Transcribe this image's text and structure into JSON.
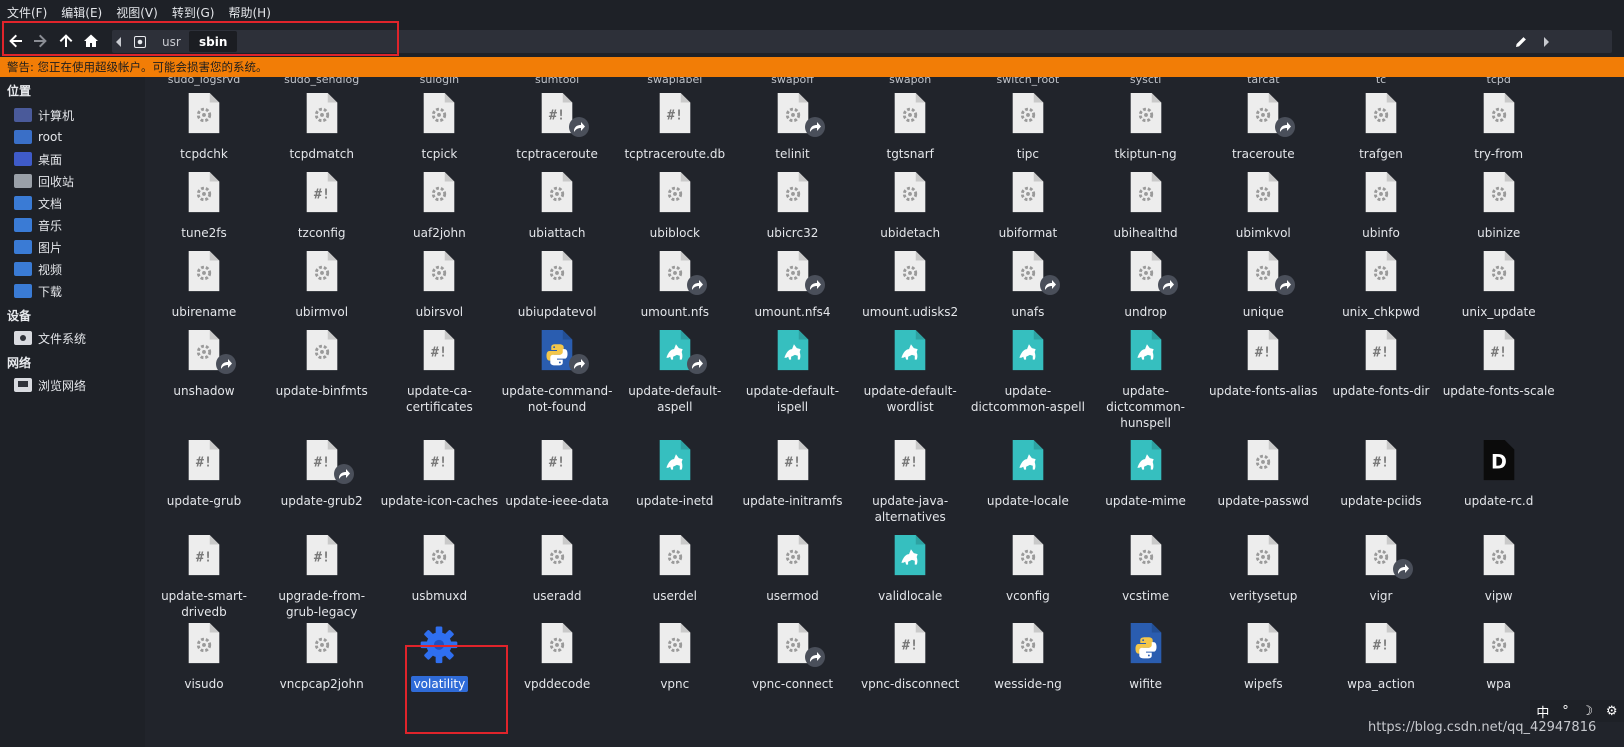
{
  "menu": [
    "文件(F)",
    "编辑(E)",
    "视图(V)",
    "转到(G)",
    "帮助(H)"
  ],
  "path": {
    "crumbs": [
      "usr",
      "sbin"
    ]
  },
  "warning": "警告: 您正在使用超级帐户。可能会损害您的系统。",
  "sidebar": {
    "headings": [
      "位置",
      "设备",
      "网络"
    ],
    "places": [
      {
        "label": "计算机",
        "icon": "computer-icon",
        "color": "#4a5a9a"
      },
      {
        "label": "root",
        "icon": "home-folder-icon",
        "color": "#3a6fc7"
      },
      {
        "label": "桌面",
        "icon": "desktop-icon",
        "color": "#3f5bc9"
      },
      {
        "label": "回收站",
        "icon": "trash-icon",
        "color": "#9aa0a8"
      },
      {
        "label": "文档",
        "icon": "documents-icon",
        "color": "#3a7bd5"
      },
      {
        "label": "音乐",
        "icon": "music-icon",
        "color": "#3a7bd5"
      },
      {
        "label": "图片",
        "icon": "pictures-icon",
        "color": "#3a7bd5"
      },
      {
        "label": "视频",
        "icon": "videos-icon",
        "color": "#3a7bd5"
      },
      {
        "label": "下载",
        "icon": "downloads-icon",
        "color": "#3a7bd5"
      }
    ],
    "devices": [
      {
        "label": "文件系统",
        "icon": "drive-icon"
      }
    ],
    "network": [
      {
        "label": "浏览网络",
        "icon": "network-icon"
      }
    ]
  },
  "top_partial_row": [
    "sudo_logsrvd",
    "sudo_sendlog",
    "sulogin",
    "sumtool",
    "swaplabel",
    "swapoff",
    "swapon",
    "switch_root",
    "sysctl",
    "tarcat",
    "tc",
    "tcpd"
  ],
  "rows": [
    [
      {
        "name": "tcpdchk",
        "type": "binary",
        "link": false
      },
      {
        "name": "tcpdmatch",
        "type": "binary",
        "link": false
      },
      {
        "name": "tcpick",
        "type": "binary",
        "link": false
      },
      {
        "name": "tcptraceroute",
        "type": "script",
        "link": true
      },
      {
        "name": "tcptraceroute.db",
        "type": "script",
        "link": false
      },
      {
        "name": "telinit",
        "type": "binary",
        "link": true
      },
      {
        "name": "tgtsnarf",
        "type": "binary",
        "link": false
      },
      {
        "name": "tipc",
        "type": "binary",
        "link": false
      },
      {
        "name": "tkiptun-ng",
        "type": "binary",
        "link": false
      },
      {
        "name": "traceroute",
        "type": "binary",
        "link": true
      },
      {
        "name": "trafgen",
        "type": "binary",
        "link": false
      },
      {
        "name": "try-from",
        "type": "binary",
        "link": false
      }
    ],
    [
      {
        "name": "tune2fs",
        "type": "binary",
        "link": false
      },
      {
        "name": "tzconfig",
        "type": "script",
        "link": false
      },
      {
        "name": "uaf2john",
        "type": "binary",
        "link": false
      },
      {
        "name": "ubiattach",
        "type": "binary",
        "link": false
      },
      {
        "name": "ubiblock",
        "type": "binary",
        "link": false
      },
      {
        "name": "ubicrc32",
        "type": "binary",
        "link": false
      },
      {
        "name": "ubidetach",
        "type": "binary",
        "link": false
      },
      {
        "name": "ubiformat",
        "type": "binary",
        "link": false
      },
      {
        "name": "ubihealthd",
        "type": "binary",
        "link": false
      },
      {
        "name": "ubimkvol",
        "type": "binary",
        "link": false
      },
      {
        "name": "ubinfo",
        "type": "binary",
        "link": false
      },
      {
        "name": "ubinize",
        "type": "binary",
        "link": false
      }
    ],
    [
      {
        "name": "ubirename",
        "type": "binary",
        "link": false
      },
      {
        "name": "ubirmvol",
        "type": "binary",
        "link": false
      },
      {
        "name": "ubirsvol",
        "type": "binary",
        "link": false
      },
      {
        "name": "ubiupdatevol",
        "type": "binary",
        "link": false
      },
      {
        "name": "umount.nfs",
        "type": "binary",
        "link": true
      },
      {
        "name": "umount.nfs4",
        "type": "binary",
        "link": true
      },
      {
        "name": "umount.udisks2",
        "type": "binary",
        "link": false
      },
      {
        "name": "unafs",
        "type": "binary",
        "link": true
      },
      {
        "name": "undrop",
        "type": "binary",
        "link": true
      },
      {
        "name": "unique",
        "type": "binary",
        "link": true
      },
      {
        "name": "unix_chkpwd",
        "type": "binary",
        "link": false
      },
      {
        "name": "unix_update",
        "type": "binary",
        "link": false
      }
    ],
    [
      {
        "name": "unshadow",
        "type": "binary",
        "link": true
      },
      {
        "name": "update-binfmts",
        "type": "binary",
        "link": false
      },
      {
        "name": "update-ca-certificates",
        "type": "script",
        "link": false
      },
      {
        "name": "update-command-not-found",
        "type": "python",
        "link": true
      },
      {
        "name": "update-default-aspell",
        "type": "perl",
        "link": true
      },
      {
        "name": "update-default-ispell",
        "type": "perl",
        "link": false
      },
      {
        "name": "update-default-wordlist",
        "type": "perl",
        "link": false
      },
      {
        "name": "update-dictcommon-aspell",
        "type": "perl",
        "link": false
      },
      {
        "name": "update-dictcommon-hunspell",
        "type": "perl",
        "link": false
      },
      {
        "name": "update-fonts-alias",
        "type": "script",
        "link": false
      },
      {
        "name": "update-fonts-dir",
        "type": "script",
        "link": false
      },
      {
        "name": "update-fonts-scale",
        "type": "script",
        "link": false
      }
    ],
    [
      {
        "name": "update-grub",
        "type": "script",
        "link": false
      },
      {
        "name": "update-grub2",
        "type": "script",
        "link": true
      },
      {
        "name": "update-icon-caches",
        "type": "script",
        "link": false
      },
      {
        "name": "update-ieee-data",
        "type": "script",
        "link": false
      },
      {
        "name": "update-inetd",
        "type": "perl",
        "link": false
      },
      {
        "name": "update-initramfs",
        "type": "script",
        "link": false
      },
      {
        "name": "update-java-alternatives",
        "type": "script",
        "link": false
      },
      {
        "name": "update-locale",
        "type": "perl",
        "link": false
      },
      {
        "name": "update-mime",
        "type": "perl",
        "link": false
      },
      {
        "name": "update-passwd",
        "type": "binary",
        "link": false
      },
      {
        "name": "update-pciids",
        "type": "script",
        "link": false
      },
      {
        "name": "update-rc.d",
        "type": "dlang",
        "link": false
      }
    ],
    [
      {
        "name": "update-smart-drivedb",
        "type": "script",
        "link": false
      },
      {
        "name": "upgrade-from-grub-legacy",
        "type": "script",
        "link": false
      },
      {
        "name": "usbmuxd",
        "type": "binary",
        "link": false
      },
      {
        "name": "useradd",
        "type": "binary",
        "link": false
      },
      {
        "name": "userdel",
        "type": "binary",
        "link": false
      },
      {
        "name": "usermod",
        "type": "binary",
        "link": false
      },
      {
        "name": "validlocale",
        "type": "perl",
        "link": false
      },
      {
        "name": "vconfig",
        "type": "binary",
        "link": false
      },
      {
        "name": "vcstime",
        "type": "binary",
        "link": false
      },
      {
        "name": "veritysetup",
        "type": "binary",
        "link": false
      },
      {
        "name": "vigr",
        "type": "binary",
        "link": true
      },
      {
        "name": "vipw",
        "type": "binary",
        "link": false
      }
    ],
    [
      {
        "name": "visudo",
        "type": "binary",
        "link": false
      },
      {
        "name": "vncpcap2john",
        "type": "binary",
        "link": false
      },
      {
        "name": "volatility",
        "type": "gear",
        "link": false,
        "selected": true
      },
      {
        "name": "vpddecode",
        "type": "binary",
        "link": false
      },
      {
        "name": "vpnc",
        "type": "binary",
        "link": false
      },
      {
        "name": "vpnc-connect",
        "type": "binary",
        "link": true
      },
      {
        "name": "vpnc-disconnect",
        "type": "script",
        "link": false
      },
      {
        "name": "wesside-ng",
        "type": "binary",
        "link": false
      },
      {
        "name": "wifite",
        "type": "python",
        "link": false
      },
      {
        "name": "wipefs",
        "type": "binary",
        "link": false
      },
      {
        "name": "wpa_action",
        "type": "script",
        "link": false
      },
      {
        "name": "wpa",
        "type": "binary",
        "link": false
      }
    ]
  ],
  "tray": [
    "中",
    "°",
    "☽",
    "⚙"
  ],
  "watermark": "https://blog.csdn.net/qq_42947816",
  "colors": {
    "warning": "#f27d06",
    "selection": "#2f6bd8",
    "perl": "#36bfbf",
    "python": "#2a5db0"
  }
}
